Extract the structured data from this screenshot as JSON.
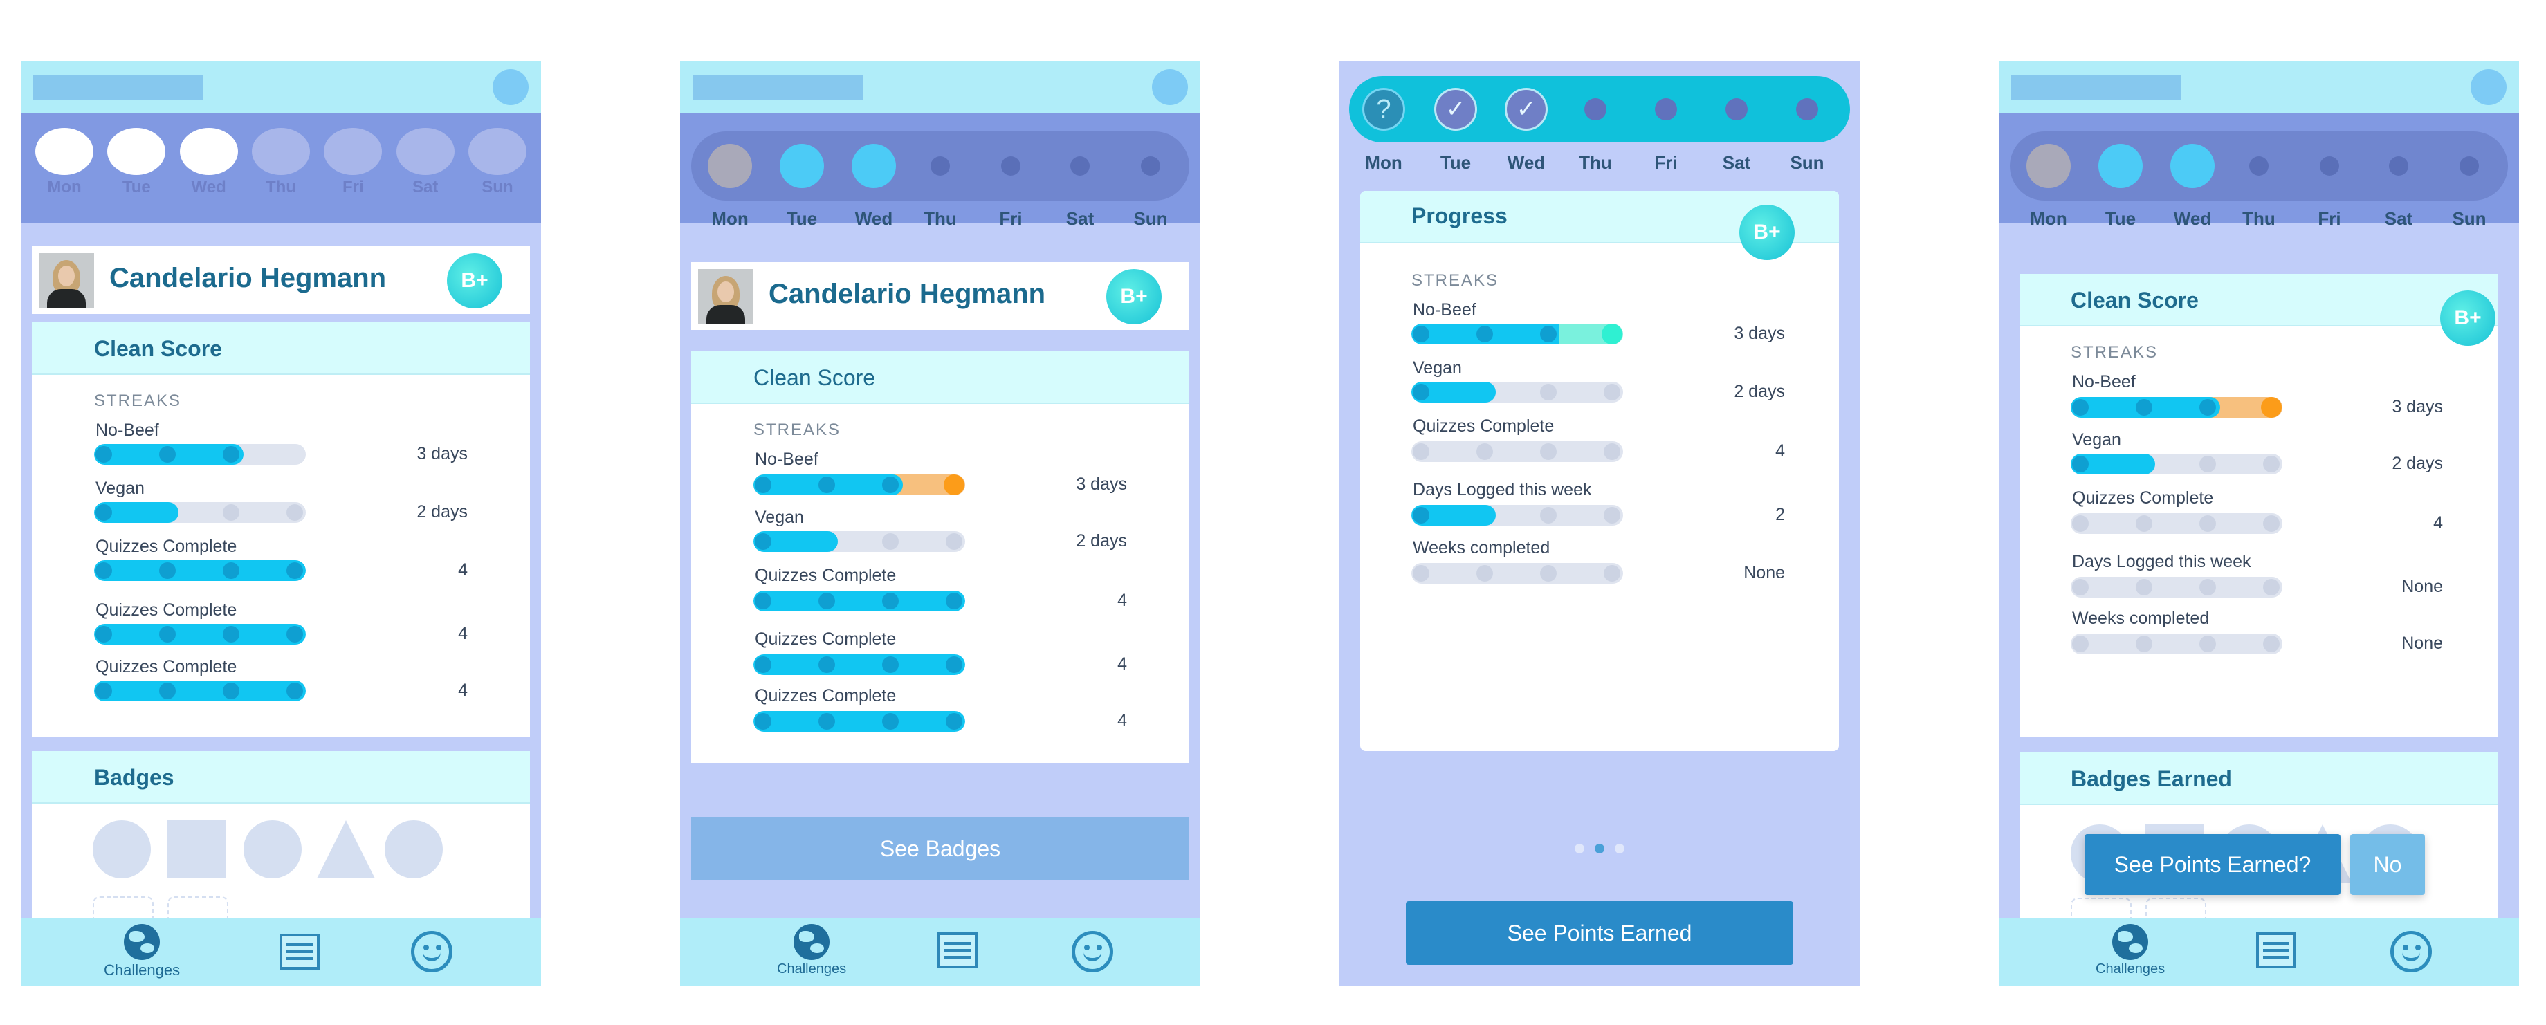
{
  "colors": {
    "accent": "#11c6f2",
    "header": "#b0edf9",
    "background": "#c0cdf9",
    "warning": "#fc9c19"
  },
  "days": [
    "Mon",
    "Tue",
    "Wed",
    "Thu",
    "Fri",
    "Sat",
    "Sun"
  ],
  "user": {
    "name": "Candelario Hegmann",
    "grade": "B+"
  },
  "nav": {
    "challenges": "Challenges",
    "globe_icon": "globe-icon",
    "news_icon": "newspaper-icon",
    "smile_icon": "smiley-icon"
  },
  "screen1": {
    "clean_score": "Clean Score",
    "streaks": "STREAKS",
    "rows": [
      {
        "label": "No-Beef",
        "value": "3 days",
        "progress": 0.7
      },
      {
        "label": "Vegan",
        "value": "2 days",
        "progress": 0.4
      },
      {
        "label": "Quizzes Complete",
        "value": "4",
        "progress": 1.0
      },
      {
        "label": "Quizzes Complete",
        "value": "4",
        "progress": 1.0
      },
      {
        "label": "Quizzes Complete",
        "value": "4",
        "progress": 1.0
      }
    ],
    "badges": "Badges"
  },
  "screen2": {
    "clean_score": "Clean Score",
    "streaks": "STREAKS",
    "rows": [
      {
        "label": "No-Beef",
        "value": "3 days",
        "progress": 0.7
      },
      {
        "label": "Vegan",
        "value": "2 days",
        "progress": 0.4
      },
      {
        "label": "Quizzes Complete",
        "value": "4",
        "progress": 1.0
      },
      {
        "label": "Quizzes Complete",
        "value": "4",
        "progress": 1.0
      },
      {
        "label": "Quizzes Complete",
        "value": "4",
        "progress": 1.0
      }
    ],
    "see_badges": "See Badges"
  },
  "screen3": {
    "question_mark": "?",
    "check": "✓",
    "progress": "Progress",
    "streaks": "STREAKS",
    "rows": [
      {
        "label": "No-Beef",
        "value": "3 days",
        "progress": 1.0
      },
      {
        "label": "Vegan",
        "value": "2 days",
        "progress": 0.4
      },
      {
        "label": "Quizzes Complete",
        "value": "4",
        "progress": 0
      },
      {
        "label": "Days Logged this week",
        "value": "2",
        "progress": 0.4
      },
      {
        "label": "Weeks completed",
        "value": "None",
        "progress": 0
      }
    ],
    "see_points": "See Points Earned"
  },
  "screen4": {
    "clean_score": "Clean Score",
    "streaks": "STREAKS",
    "rows": [
      {
        "label": "No-Beef",
        "value": "3 days",
        "progress": 0.7
      },
      {
        "label": "Vegan",
        "value": "2 days",
        "progress": 0.4
      },
      {
        "label": "Quizzes Complete",
        "value": "4",
        "progress": 0
      },
      {
        "label": "Days Logged this week",
        "value": "None",
        "progress": 0
      },
      {
        "label": "Weeks completed",
        "value": "None",
        "progress": 0
      }
    ],
    "badges_earned": "Badges Earned",
    "see_points_q": "See Points Earned?",
    "no": "No"
  }
}
